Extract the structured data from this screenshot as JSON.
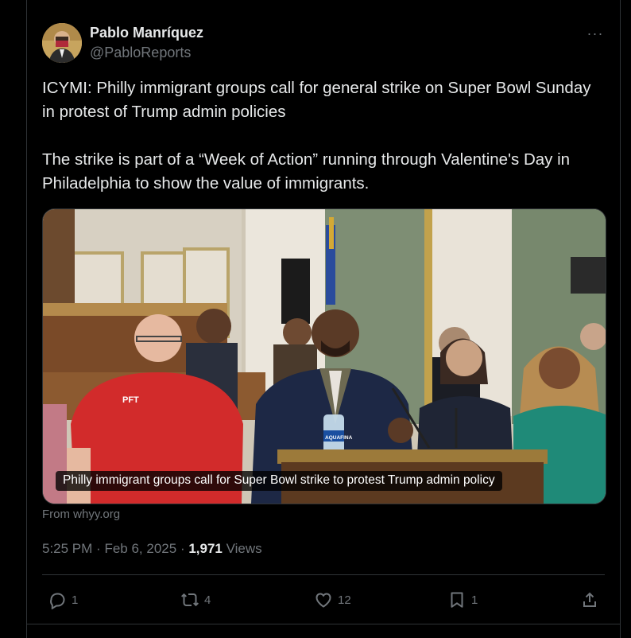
{
  "author": {
    "name": "Pablo Manríquez",
    "handle": "@PabloReports"
  },
  "more_label": "···",
  "tweet": {
    "text": "ICYMI: Philly immigrant groups call for general strike on Super Bowl Sunday in protest of Trump admin policies\n\nThe strike is part of a “Week of Action” running through Valentine's Day in Philadelphia to show the value of immigrants."
  },
  "media": {
    "caption": "Philly immigrant groups call for Super Bowl strike to protest Trump admin policy",
    "source": "From whyy.org",
    "bottle_label": "AQUAFINA",
    "shirt_text": "PFT"
  },
  "meta": {
    "time": "5:25 PM",
    "date": "Feb 6, 2025",
    "separator": "·",
    "views_count": "1,971",
    "views_label": "Views"
  },
  "actions": {
    "reply_count": "1",
    "repost_count": "4",
    "like_count": "12",
    "bookmark_count": "1"
  },
  "icons": [
    "reply-icon",
    "repost-icon",
    "like-icon",
    "bookmark-icon",
    "share-icon",
    "more-icon"
  ],
  "colors": {
    "background": "#000000",
    "text_primary": "#e7e9ea",
    "text_secondary": "#71767b",
    "border": "#2f3336"
  }
}
